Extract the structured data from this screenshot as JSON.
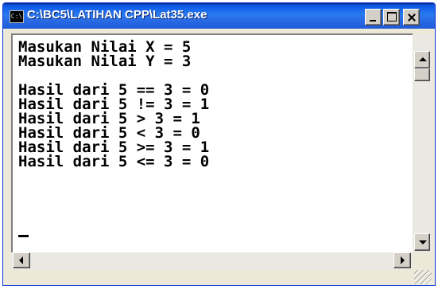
{
  "window": {
    "title": "C:\\BC5\\LATIHAN CPP\\Lat35.exe",
    "icon_label": "C:\\"
  },
  "console": {
    "output": "Masukan Nilai X = 5\nMasukan Nilai Y = 3\n\nHasil dari 5 == 3 = 0\nHasil dari 5 != 3 = 1\nHasil dari 5 > 3 = 1\nHasil dari 5 < 3 = 0\nHasil dari 5 >= 3 = 1\nHasil dari 5 <= 3 = 0"
  },
  "icons": {
    "app": "console-icon",
    "minimize": "minimize-icon",
    "maximize": "maximize-icon",
    "close": "close-icon",
    "up": "arrow-up-icon",
    "down": "arrow-down-icon",
    "left": "arrow-left-icon",
    "right": "arrow-right-icon",
    "grip": "resize-grip-icon"
  }
}
